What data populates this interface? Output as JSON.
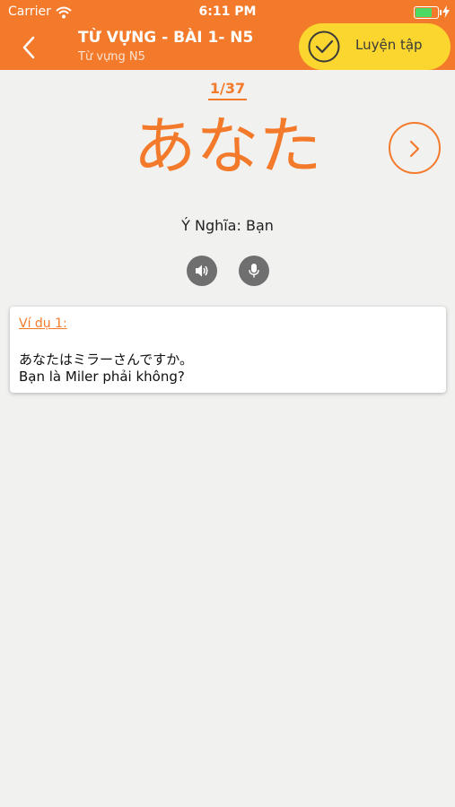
{
  "status_bar": {
    "carrier": "Carrier",
    "time": "6:11 PM",
    "icons": [
      "wifi-icon",
      "battery-icon",
      "charging-bolt-icon"
    ],
    "battery_level": 0.7
  },
  "header": {
    "title": "TỪ VỰNG - BÀI 1- N5",
    "subtitle": "Từ vựng N5",
    "back_icon": "chevron-left-icon",
    "practice_button": {
      "label": "Luyện tập",
      "icon": "check-circle-icon"
    }
  },
  "flashcard": {
    "counter": "1/37",
    "word": "あなた",
    "meaning": "Ý Nghĩa: Bạn",
    "next_icon": "chevron-right-icon",
    "audio_icon": "speaker-icon",
    "record_icon": "microphone-icon"
  },
  "example": {
    "title": "Ví dụ 1:",
    "japanese": "あなたはミラーさんですか。",
    "vietnamese": "Bạn là Miler phải không?"
  },
  "colors": {
    "primary": "#f47a2b",
    "practice_button": "#fbd62e",
    "background": "#f1f1f0",
    "icon_circle": "#6f6f6f"
  }
}
